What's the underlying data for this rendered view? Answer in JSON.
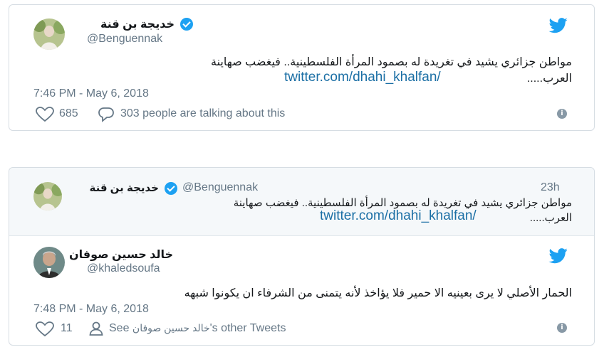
{
  "tweet1": {
    "author_name": "خديجة بن قنة",
    "handle": "@Benguennak",
    "text": "مواطن جزائري يشيد في تغريدة له بصمود المرأة الفلسطينية.. فيغضب صهاينة",
    "text_line2": "العرب.....",
    "link": "twitter.com/dhahi_khalfan/",
    "timestamp": "7:46 PM - May 6, 2018",
    "likes": "685",
    "talking": "303 people are talking about this"
  },
  "tweet2": {
    "quoted": {
      "author_name": "خديجة بن قنة",
      "handle": "@Benguennak",
      "age": "23h",
      "text": "مواطن جزائري يشيد في تغريدة له بصمود المرأة الفلسطينية.. فيغضب صهاينة",
      "text_line2": "العرب.....",
      "link": "twitter.com/dhahi_khalfan/"
    },
    "author_name": "خالد حسين صوفان",
    "handle": "@khaledsoufa",
    "text": "الحمار الأصلي لا يرى بعينيه الا حمير فلا يؤاخذ لأنه يتمنى من الشرفاء ان يكونوا شبهه",
    "timestamp": "7:48 PM - May 6, 2018",
    "likes": "11",
    "see_prefix": "See",
    "see_name": "خالد حسين صوفان",
    "see_suffix": "'s other Tweets"
  },
  "colors": {
    "twitter_blue": "#1da1f2",
    "link": "#1b6fa5",
    "muted": "#657786"
  },
  "icons": [
    "avatar",
    "verified-badge-icon",
    "twitter-bird-icon",
    "heart-icon",
    "comment-icon",
    "person-icon",
    "info-icon"
  ]
}
